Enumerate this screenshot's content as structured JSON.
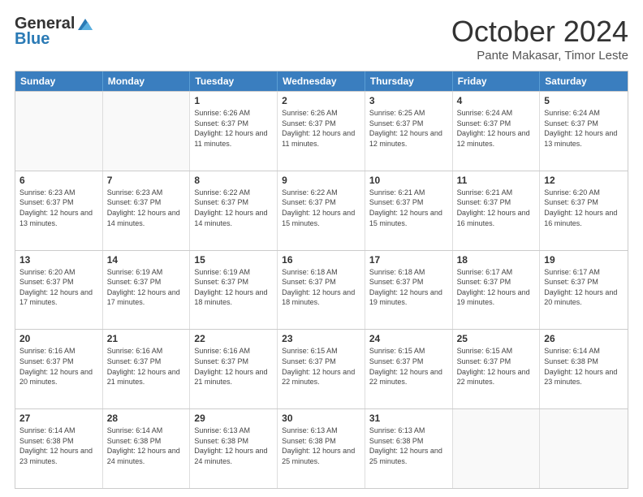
{
  "header": {
    "logo_general": "General",
    "logo_blue": "Blue",
    "month_title": "October 2024",
    "subtitle": "Pante Makasar, Timor Leste"
  },
  "days_of_week": [
    "Sunday",
    "Monday",
    "Tuesday",
    "Wednesday",
    "Thursday",
    "Friday",
    "Saturday"
  ],
  "weeks": [
    [
      {
        "day": null,
        "text": null
      },
      {
        "day": null,
        "text": null
      },
      {
        "day": "1",
        "text": "Sunrise: 6:26 AM\nSunset: 6:37 PM\nDaylight: 12 hours and 11 minutes."
      },
      {
        "day": "2",
        "text": "Sunrise: 6:26 AM\nSunset: 6:37 PM\nDaylight: 12 hours and 11 minutes."
      },
      {
        "day": "3",
        "text": "Sunrise: 6:25 AM\nSunset: 6:37 PM\nDaylight: 12 hours and 12 minutes."
      },
      {
        "day": "4",
        "text": "Sunrise: 6:24 AM\nSunset: 6:37 PM\nDaylight: 12 hours and 12 minutes."
      },
      {
        "day": "5",
        "text": "Sunrise: 6:24 AM\nSunset: 6:37 PM\nDaylight: 12 hours and 13 minutes."
      }
    ],
    [
      {
        "day": "6",
        "text": "Sunrise: 6:23 AM\nSunset: 6:37 PM\nDaylight: 12 hours and 13 minutes."
      },
      {
        "day": "7",
        "text": "Sunrise: 6:23 AM\nSunset: 6:37 PM\nDaylight: 12 hours and 14 minutes."
      },
      {
        "day": "8",
        "text": "Sunrise: 6:22 AM\nSunset: 6:37 PM\nDaylight: 12 hours and 14 minutes."
      },
      {
        "day": "9",
        "text": "Sunrise: 6:22 AM\nSunset: 6:37 PM\nDaylight: 12 hours and 15 minutes."
      },
      {
        "day": "10",
        "text": "Sunrise: 6:21 AM\nSunset: 6:37 PM\nDaylight: 12 hours and 15 minutes."
      },
      {
        "day": "11",
        "text": "Sunrise: 6:21 AM\nSunset: 6:37 PM\nDaylight: 12 hours and 16 minutes."
      },
      {
        "day": "12",
        "text": "Sunrise: 6:20 AM\nSunset: 6:37 PM\nDaylight: 12 hours and 16 minutes."
      }
    ],
    [
      {
        "day": "13",
        "text": "Sunrise: 6:20 AM\nSunset: 6:37 PM\nDaylight: 12 hours and 17 minutes."
      },
      {
        "day": "14",
        "text": "Sunrise: 6:19 AM\nSunset: 6:37 PM\nDaylight: 12 hours and 17 minutes."
      },
      {
        "day": "15",
        "text": "Sunrise: 6:19 AM\nSunset: 6:37 PM\nDaylight: 12 hours and 18 minutes."
      },
      {
        "day": "16",
        "text": "Sunrise: 6:18 AM\nSunset: 6:37 PM\nDaylight: 12 hours and 18 minutes."
      },
      {
        "day": "17",
        "text": "Sunrise: 6:18 AM\nSunset: 6:37 PM\nDaylight: 12 hours and 19 minutes."
      },
      {
        "day": "18",
        "text": "Sunrise: 6:17 AM\nSunset: 6:37 PM\nDaylight: 12 hours and 19 minutes."
      },
      {
        "day": "19",
        "text": "Sunrise: 6:17 AM\nSunset: 6:37 PM\nDaylight: 12 hours and 20 minutes."
      }
    ],
    [
      {
        "day": "20",
        "text": "Sunrise: 6:16 AM\nSunset: 6:37 PM\nDaylight: 12 hours and 20 minutes."
      },
      {
        "day": "21",
        "text": "Sunrise: 6:16 AM\nSunset: 6:37 PM\nDaylight: 12 hours and 21 minutes."
      },
      {
        "day": "22",
        "text": "Sunrise: 6:16 AM\nSunset: 6:37 PM\nDaylight: 12 hours and 21 minutes."
      },
      {
        "day": "23",
        "text": "Sunrise: 6:15 AM\nSunset: 6:37 PM\nDaylight: 12 hours and 22 minutes."
      },
      {
        "day": "24",
        "text": "Sunrise: 6:15 AM\nSunset: 6:37 PM\nDaylight: 12 hours and 22 minutes."
      },
      {
        "day": "25",
        "text": "Sunrise: 6:15 AM\nSunset: 6:37 PM\nDaylight: 12 hours and 22 minutes."
      },
      {
        "day": "26",
        "text": "Sunrise: 6:14 AM\nSunset: 6:38 PM\nDaylight: 12 hours and 23 minutes."
      }
    ],
    [
      {
        "day": "27",
        "text": "Sunrise: 6:14 AM\nSunset: 6:38 PM\nDaylight: 12 hours and 23 minutes."
      },
      {
        "day": "28",
        "text": "Sunrise: 6:14 AM\nSunset: 6:38 PM\nDaylight: 12 hours and 24 minutes."
      },
      {
        "day": "29",
        "text": "Sunrise: 6:13 AM\nSunset: 6:38 PM\nDaylight: 12 hours and 24 minutes."
      },
      {
        "day": "30",
        "text": "Sunrise: 6:13 AM\nSunset: 6:38 PM\nDaylight: 12 hours and 25 minutes."
      },
      {
        "day": "31",
        "text": "Sunrise: 6:13 AM\nSunset: 6:38 PM\nDaylight: 12 hours and 25 minutes."
      },
      {
        "day": null,
        "text": null
      },
      {
        "day": null,
        "text": null
      }
    ]
  ]
}
